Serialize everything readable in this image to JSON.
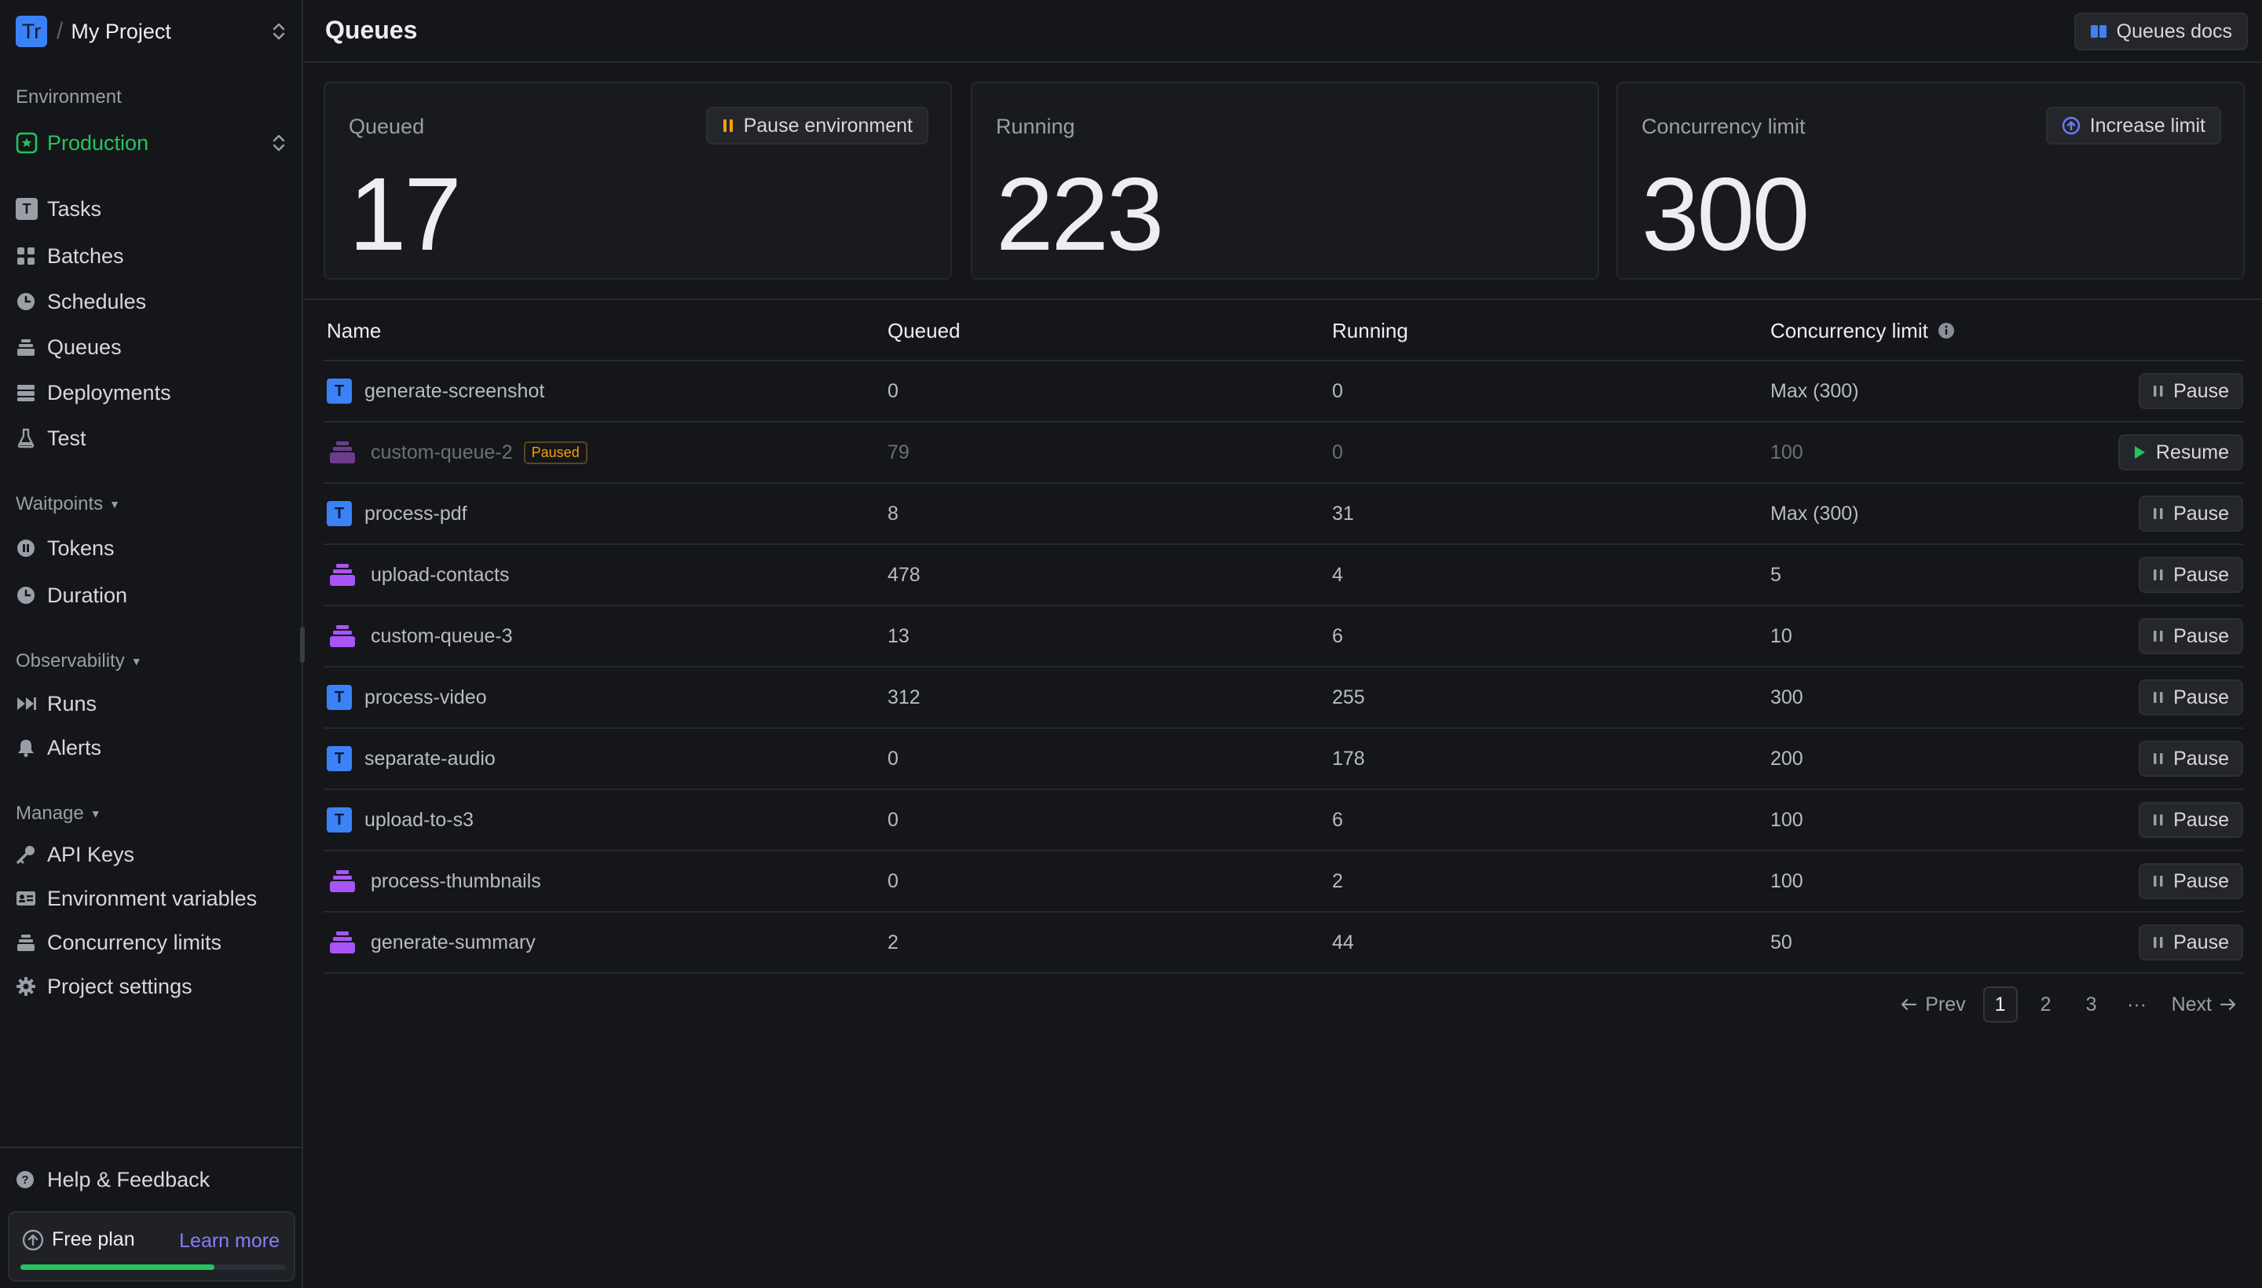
{
  "project": {
    "logo_text": "Tr",
    "name": "My Project"
  },
  "environment": {
    "section_label": "Environment",
    "current": "Production"
  },
  "nav": {
    "main": [
      {
        "label": "Tasks",
        "icon": "task-icon"
      },
      {
        "label": "Batches",
        "icon": "batches-icon"
      },
      {
        "label": "Schedules",
        "icon": "clock-icon"
      },
      {
        "label": "Queues",
        "icon": "queue-icon"
      },
      {
        "label": "Deployments",
        "icon": "server-icon"
      },
      {
        "label": "Test",
        "icon": "flask-icon"
      }
    ],
    "waitpoints": {
      "label": "Waitpoints",
      "items": [
        {
          "label": "Tokens"
        },
        {
          "label": "Duration"
        }
      ]
    },
    "observability": {
      "label": "Observability",
      "items": [
        {
          "label": "Runs"
        },
        {
          "label": "Alerts"
        }
      ]
    },
    "manage": {
      "label": "Manage",
      "items": [
        {
          "label": "API Keys"
        },
        {
          "label": "Environment variables"
        },
        {
          "label": "Concurrency limits"
        },
        {
          "label": "Project settings"
        }
      ]
    }
  },
  "footer": {
    "help": "Help & Feedback",
    "plan": "Free plan",
    "learn_more": "Learn more",
    "plan_usage_fraction": 0.73
  },
  "header": {
    "title": "Queues",
    "docs_button": "Queues docs"
  },
  "stats": {
    "queued": {
      "label": "Queued",
      "value": "17",
      "button": "Pause environment"
    },
    "running": {
      "label": "Running",
      "value": "223"
    },
    "limit": {
      "label": "Concurrency limit",
      "value": "300",
      "button": "Increase limit"
    }
  },
  "table": {
    "columns": [
      "Name",
      "Queued",
      "Running",
      "Concurrency limit"
    ],
    "rows": [
      {
        "type": "task",
        "name": "generate-screenshot",
        "queued": "0",
        "running": "0",
        "limit": "Max (300)",
        "action": "Pause"
      },
      {
        "type": "queue",
        "name": "custom-queue-2",
        "badge": "Paused",
        "queued": "79",
        "running": "0",
        "limit": "100",
        "action": "Resume"
      },
      {
        "type": "task",
        "name": "process-pdf",
        "queued": "8",
        "running": "31",
        "limit": "Max (300)",
        "action": "Pause"
      },
      {
        "type": "queue",
        "name": "upload-contacts",
        "queued": "478",
        "running": "4",
        "limit": "5",
        "action": "Pause"
      },
      {
        "type": "queue",
        "name": "custom-queue-3",
        "queued": "13",
        "running": "6",
        "limit": "10",
        "action": "Pause"
      },
      {
        "type": "task",
        "name": "process-video",
        "queued": "312",
        "running": "255",
        "limit": "300",
        "action": "Pause"
      },
      {
        "type": "task",
        "name": "separate-audio",
        "queued": "0",
        "running": "178",
        "limit": "200",
        "action": "Pause"
      },
      {
        "type": "task",
        "name": "upload-to-s3",
        "queued": "0",
        "running": "6",
        "limit": "100",
        "action": "Pause"
      },
      {
        "type": "queue",
        "name": "process-thumbnails",
        "queued": "0",
        "running": "2",
        "limit": "100",
        "action": "Pause"
      },
      {
        "type": "queue",
        "name": "generate-summary",
        "queued": "2",
        "running": "44",
        "limit": "50",
        "action": "Pause"
      }
    ]
  },
  "pagination": {
    "prev": "Prev",
    "next": "Next",
    "pages": [
      "1",
      "2",
      "3"
    ],
    "ellipsis": "···",
    "current": "1"
  },
  "colors": {
    "accent_green": "#22c55e",
    "task_blue": "#3b82f6",
    "queue_purple": "#a855f7",
    "paused_amber": "#f59e0b",
    "link_purple": "#8b7cf6"
  }
}
